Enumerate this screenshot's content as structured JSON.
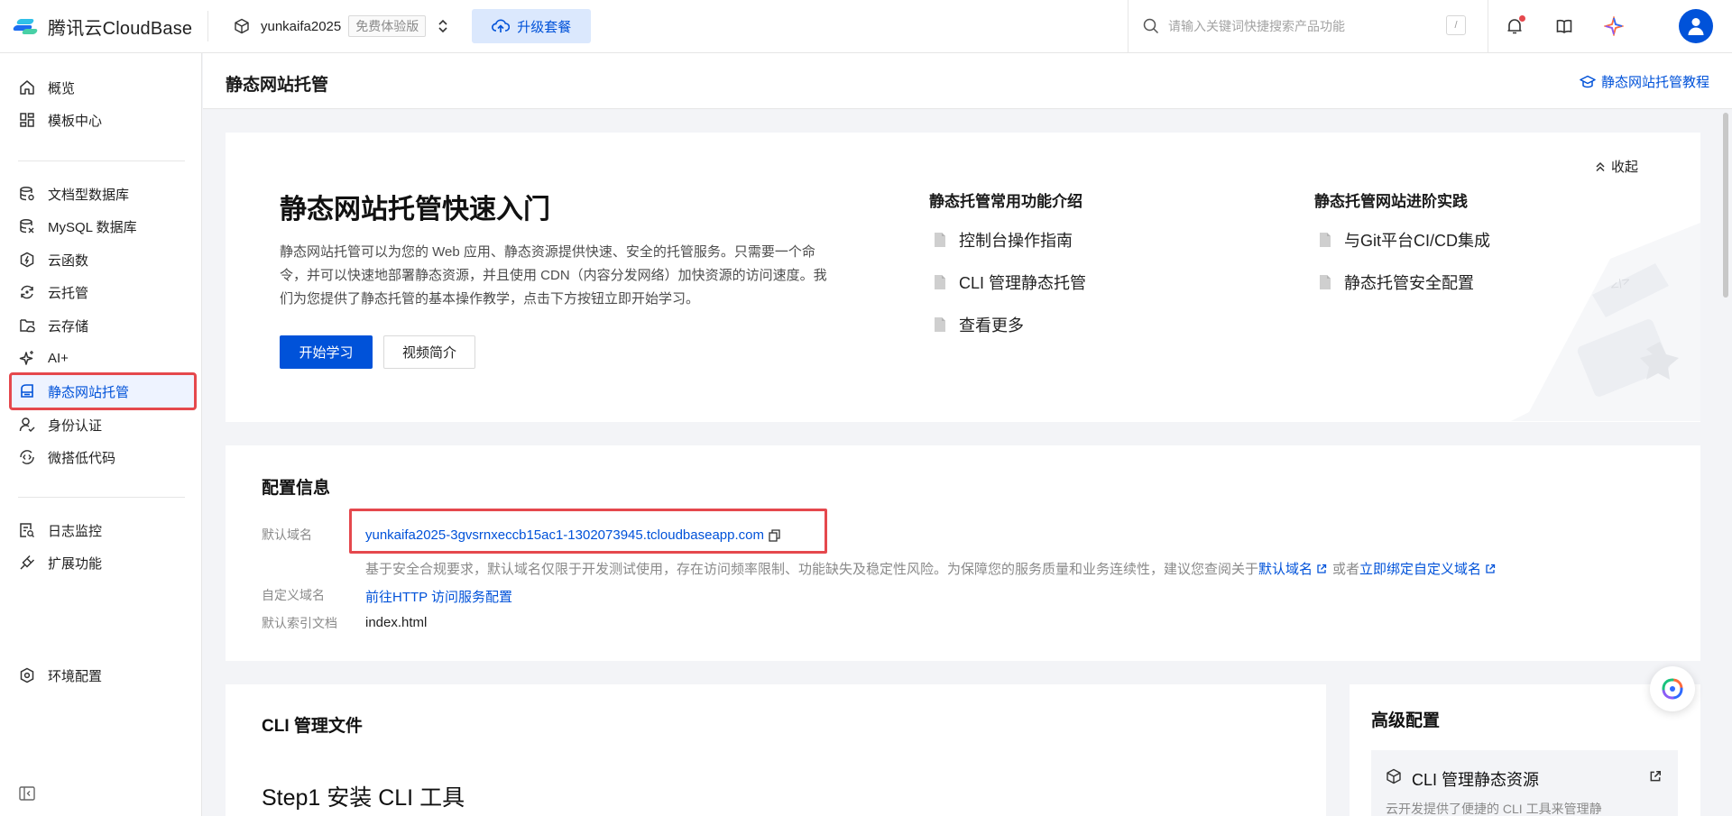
{
  "topbar": {
    "brand": "腾讯云CloudBase",
    "env_name": "yunkaifa2025",
    "env_badge": "免费体验版",
    "upgrade_label": "升级套餐",
    "search_placeholder": "请输入关键词快捷搜索产品功能",
    "search_shortcut": "/"
  },
  "sidebar": {
    "items": [
      {
        "label": "概览",
        "icon": "home-icon"
      },
      {
        "label": "模板中心",
        "icon": "grid-icon"
      },
      {
        "label": "文档型数据库",
        "icon": "database-icon"
      },
      {
        "label": "MySQL 数据库",
        "icon": "mysql-database-icon"
      },
      {
        "label": "云函数",
        "icon": "function-icon"
      },
      {
        "label": "云托管",
        "icon": "cloud-run-icon"
      },
      {
        "label": "云存储",
        "icon": "storage-icon"
      },
      {
        "label": "AI+",
        "icon": "sparkle-icon"
      },
      {
        "label": "静态网站托管",
        "icon": "hosting-icon",
        "active": true
      },
      {
        "label": "身份认证",
        "icon": "user-auth-icon"
      },
      {
        "label": "微搭低代码",
        "icon": "lowcode-icon"
      },
      {
        "label": "日志监控",
        "icon": "log-icon"
      },
      {
        "label": "扩展功能",
        "icon": "extension-icon"
      },
      {
        "label": "环境配置",
        "icon": "settings-icon"
      }
    ]
  },
  "page": {
    "title": "静态网站托管",
    "tutorial_link": "静态网站托管教程"
  },
  "quickstart": {
    "title": "静态网站托管快速入门",
    "description": "静态网站托管可以为您的 Web 应用、静态资源提供快速、安全的托管服务。只需要一个命令，并可以快速地部署静态资源，并且使用 CDN（内容分发网络）加快资源的访问速度。我们为您提供了静态托管的基本操作教学，点击下方按钮立即开始学习。",
    "start_button": "开始学习",
    "video_button": "视频简介",
    "collapse_label": "收起",
    "features_title": "静态托管常用功能介绍",
    "features": [
      "控制台操作指南",
      "CLI 管理静态托管",
      "查看更多"
    ],
    "advanced_title": "静态托管网站进阶实践",
    "advanced": [
      "与Git平台CI/CD集成",
      "静态托管安全配置"
    ]
  },
  "config": {
    "title": "配置信息",
    "default_domain_label": "默认域名",
    "default_domain": "yunkaifa2025-3gvsrnxeccb15ac1-1302073945.tcloudbaseapp.com",
    "note_prefix": "基于安全合规要求，默认域名仅限于开发测试使用，存在访问频率限制、功能缺失及稳定性风险。为保障您的服务质量和业务连续性，建议您查阅关于",
    "note_link1": "默认域名",
    "note_middle": "或者",
    "note_link2": "立即绑定自定义域名",
    "custom_domain_label": "自定义域名",
    "custom_domain_link": "前往HTTP 访问服务配置",
    "index_doc_label": "默认索引文档",
    "index_doc": "index.html"
  },
  "cli": {
    "title": "CLI 管理文件",
    "step1": "Step1 安装 CLI 工具"
  },
  "advanced_config": {
    "title": "高级配置",
    "item_title": "CLI 管理静态资源",
    "item_desc": "云开发提供了便捷的 CLI 工具来管理静"
  },
  "colors": {
    "primary": "#0052d9",
    "highlight": "#e5484d",
    "background": "#f3f4f7"
  }
}
